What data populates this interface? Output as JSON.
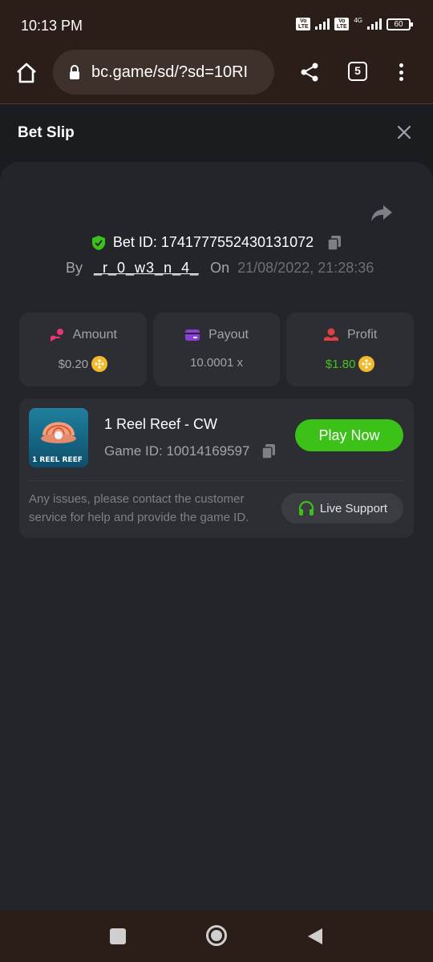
{
  "status_bar": {
    "time": "10:13 PM",
    "volte_label": "Vo LTE",
    "network_type": "4G",
    "battery": "60"
  },
  "browser": {
    "url": "bc.game/sd/?sd=10RI",
    "tab_count": "5"
  },
  "header": {
    "title": "Bet Slip"
  },
  "bet": {
    "bet_id": "Bet ID: 1741777552430131072",
    "by_label": "By",
    "username": "_r_0_w3_n_4_",
    "on_label": "On",
    "date": "21/08/2022, 21:28:36"
  },
  "stats": {
    "amount_label": "Amount",
    "amount_value": "$0.20",
    "payout_label": "Payout",
    "payout_value": "10.0001 x",
    "profit_label": "Profit",
    "profit_value": "$1.80",
    "profit_color": "#48c51a"
  },
  "game": {
    "name": "1 Reel Reef - CW",
    "game_id": "Game ID: 10014169597",
    "thumb_title": "1 REEL REEF",
    "play_button": "Play Now",
    "issue_text": "Any issues, please contact the customer service for help and provide the game ID.",
    "support_button": "Live Support"
  },
  "colors": {
    "accent_green": "#3bc117",
    "amount_icon": "#e8367a",
    "payout_icon": "#8b3fd9",
    "profit_icon": "#e04040"
  }
}
